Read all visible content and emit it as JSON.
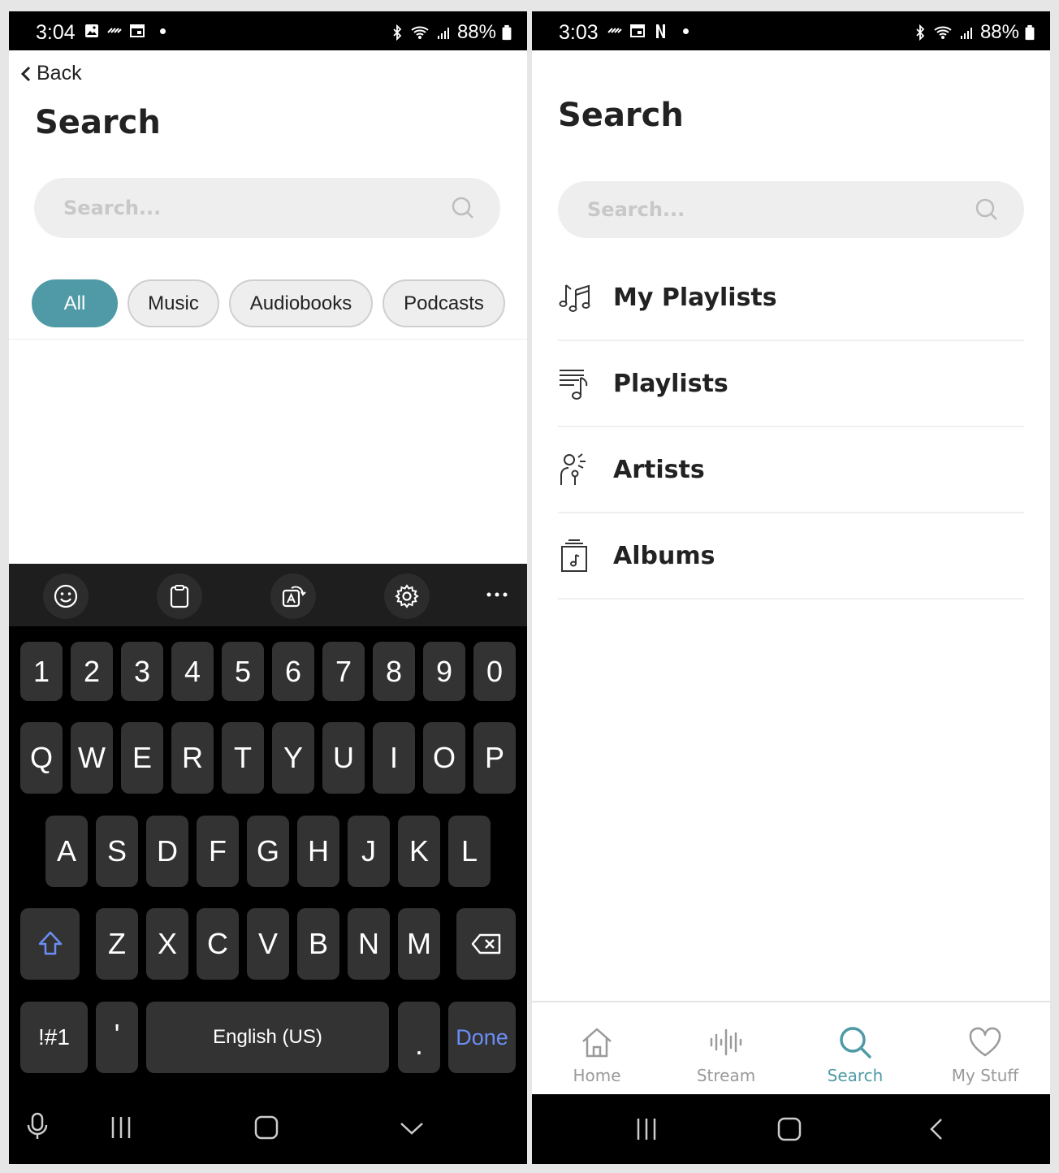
{
  "left": {
    "status": {
      "time": "3:04",
      "battery": "88%"
    },
    "back_label": "Back",
    "title": "Search",
    "search_placeholder": "Search...",
    "chips": [
      "All",
      "Music",
      "Audiobooks",
      "Podcasts"
    ],
    "keyboard": {
      "numbers": [
        "1",
        "2",
        "3",
        "4",
        "5",
        "6",
        "7",
        "8",
        "9",
        "0"
      ],
      "row1": [
        "Q",
        "W",
        "E",
        "R",
        "T",
        "Y",
        "U",
        "I",
        "O",
        "P"
      ],
      "row2": [
        "A",
        "S",
        "D",
        "F",
        "G",
        "H",
        "J",
        "K",
        "L"
      ],
      "row3": [
        "Z",
        "X",
        "C",
        "V",
        "B",
        "N",
        "M"
      ],
      "symbols_label": "!#1",
      "apostrophe": "'",
      "space_label": "English (US)",
      "period": ".",
      "done_label": "Done"
    }
  },
  "right": {
    "status": {
      "time": "3:03",
      "battery": "88%"
    },
    "title": "Search",
    "search_placeholder": "Search...",
    "list": [
      {
        "label": "My Playlists",
        "icon": "music-notes-icon"
      },
      {
        "label": "Playlists",
        "icon": "playlist-icon"
      },
      {
        "label": "Artists",
        "icon": "singer-icon"
      },
      {
        "label": "Albums",
        "icon": "album-icon"
      }
    ],
    "tabs": [
      {
        "label": "Home",
        "icon": "home-icon"
      },
      {
        "label": "Stream",
        "icon": "waveform-icon"
      },
      {
        "label": "Search",
        "icon": "search-icon"
      },
      {
        "label": "My Stuff",
        "icon": "heart-icon"
      }
    ],
    "accent_color": "#4f9aa6"
  }
}
